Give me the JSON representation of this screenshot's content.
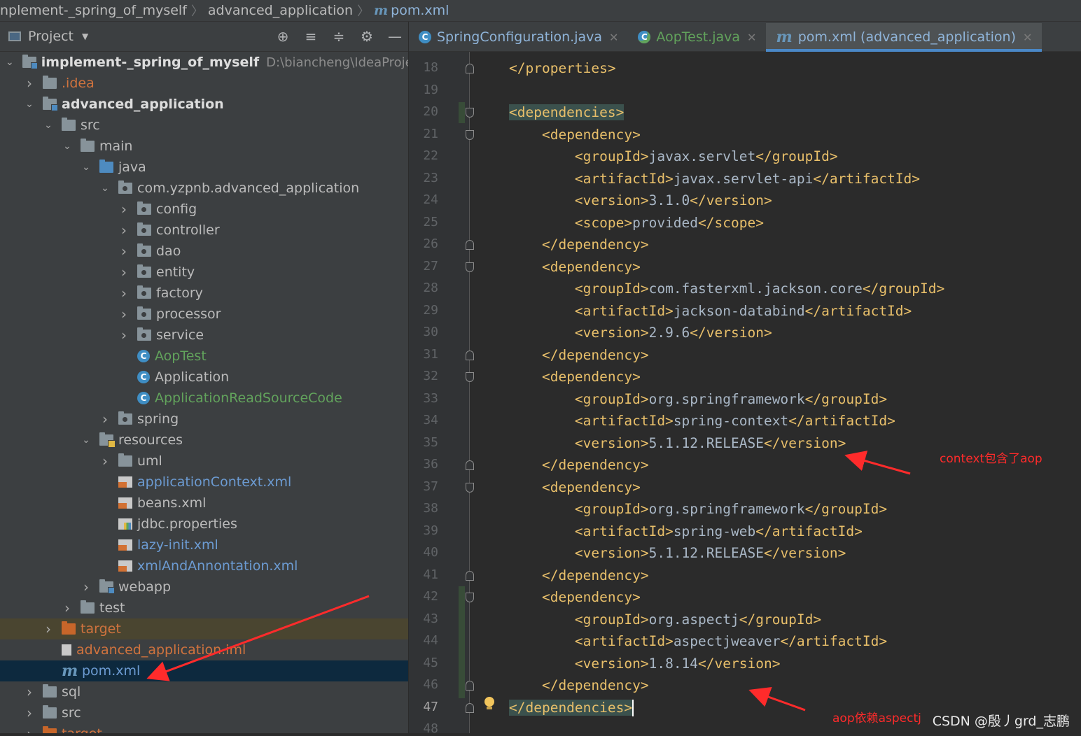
{
  "breadcrumb": {
    "root": "nplement-_spring_of_myself",
    "module": "advanced_application",
    "file": "pom.xml",
    "file_icon": "m"
  },
  "project_panel": {
    "title": "Project",
    "toolbar_icons": [
      "locate-icon",
      "expand-all-icon",
      "collapse-all-icon",
      "gear-icon",
      "minimize-icon"
    ],
    "tree": [
      {
        "label": "implement-_spring_of_myself",
        "path": "D:\\biancheng\\IdeaProjects\\ir",
        "icon": "module-folder",
        "style": "bold",
        "expanded": true
      },
      {
        "label": ".idea",
        "icon": "folder",
        "style": "orange",
        "expanded": false
      },
      {
        "label": "advanced_application",
        "icon": "module-folder",
        "style": "bold",
        "expanded": true
      },
      {
        "label": "src",
        "icon": "folder",
        "style": "normal",
        "expanded": true
      },
      {
        "label": "main",
        "icon": "folder",
        "style": "normal",
        "expanded": true
      },
      {
        "label": "java",
        "icon": "source-folder",
        "style": "normal",
        "expanded": true
      },
      {
        "label": "com.yzpnb.advanced_application",
        "icon": "package",
        "style": "normal",
        "expanded": true
      },
      {
        "label": "config",
        "icon": "package",
        "style": "normal",
        "expanded": false
      },
      {
        "label": "controller",
        "icon": "package",
        "style": "normal",
        "expanded": false
      },
      {
        "label": "dao",
        "icon": "package",
        "style": "normal",
        "expanded": false
      },
      {
        "label": "entity",
        "icon": "package",
        "style": "normal",
        "expanded": false
      },
      {
        "label": "factory",
        "icon": "package",
        "style": "normal",
        "expanded": false
      },
      {
        "label": "processor",
        "icon": "package",
        "style": "normal",
        "expanded": false
      },
      {
        "label": "service",
        "icon": "package",
        "style": "normal",
        "expanded": false
      },
      {
        "label": "AopTest",
        "icon": "class",
        "style": "green"
      },
      {
        "label": "Application",
        "icon": "class",
        "style": "normal"
      },
      {
        "label": "ApplicationReadSourceCode",
        "icon": "class",
        "style": "green"
      },
      {
        "label": "spring",
        "icon": "package",
        "style": "normal",
        "expanded": false
      },
      {
        "label": "resources",
        "icon": "resources-folder",
        "style": "normal",
        "expanded": true
      },
      {
        "label": "uml",
        "icon": "folder",
        "style": "normal",
        "expanded": false
      },
      {
        "label": "applicationContext.xml",
        "icon": "xml-file",
        "style": "blue"
      },
      {
        "label": "beans.xml",
        "icon": "xml-file",
        "style": "normal"
      },
      {
        "label": "jdbc.properties",
        "icon": "properties-file",
        "style": "normal"
      },
      {
        "label": "lazy-init.xml",
        "icon": "xml-file",
        "style": "blue"
      },
      {
        "label": "xmlAndAnnontation.xml",
        "icon": "xml-file",
        "style": "blue"
      },
      {
        "label": "webapp",
        "icon": "web-folder",
        "style": "normal",
        "expanded": false
      },
      {
        "label": "test",
        "icon": "folder",
        "style": "normal",
        "expanded": false
      },
      {
        "label": "target",
        "icon": "excluded-folder",
        "style": "orange",
        "expanded": false
      },
      {
        "label": "advanced_application.iml",
        "icon": "iml-file",
        "style": "orange"
      },
      {
        "label": "pom.xml",
        "icon": "maven-file",
        "style": "blue"
      },
      {
        "label": "sql",
        "icon": "folder",
        "style": "normal",
        "expanded": false
      },
      {
        "label": "src",
        "icon": "folder",
        "style": "normal",
        "expanded": false
      },
      {
        "label": "target",
        "icon": "excluded-folder",
        "style": "orange",
        "expanded": false
      }
    ]
  },
  "tabs": [
    {
      "label": "SpringConfiguration.java",
      "icon": "class-icon",
      "active": false,
      "color": "blue"
    },
    {
      "label": "AopTest.java",
      "icon": "test-class-icon",
      "active": false,
      "color": "green"
    },
    {
      "label": "pom.xml (advanced_application)",
      "icon": "maven-icon",
      "active": true,
      "color": "blue"
    }
  ],
  "editor": {
    "lines": [
      {
        "n": "18",
        "code": "</properties>"
      },
      {
        "n": "19",
        "code": ""
      },
      {
        "n": "20",
        "code": "<dependencies>"
      },
      {
        "n": "21",
        "code": "    <dependency>"
      },
      {
        "n": "22",
        "code": "        <groupId>javax.servlet</groupId>"
      },
      {
        "n": "23",
        "code": "        <artifactId>javax.servlet-api</artifactId>"
      },
      {
        "n": "24",
        "code": "        <version>3.1.0</version>"
      },
      {
        "n": "25",
        "code": "        <scope>provided</scope>"
      },
      {
        "n": "26",
        "code": "    </dependency>"
      },
      {
        "n": "27",
        "code": "    <dependency>"
      },
      {
        "n": "28",
        "code": "        <groupId>com.fasterxml.jackson.core</groupId>"
      },
      {
        "n": "29",
        "code": "        <artifactId>jackson-databind</artifactId>"
      },
      {
        "n": "30",
        "code": "        <version>2.9.6</version>"
      },
      {
        "n": "31",
        "code": "    </dependency>"
      },
      {
        "n": "32",
        "code": "    <dependency>"
      },
      {
        "n": "33",
        "code": "        <groupId>org.springframework</groupId>"
      },
      {
        "n": "34",
        "code": "        <artifactId>spring-context</artifactId>"
      },
      {
        "n": "35",
        "code": "        <version>5.1.12.RELEASE</version>"
      },
      {
        "n": "36",
        "code": "    </dependency>"
      },
      {
        "n": "37",
        "code": "    <dependency>"
      },
      {
        "n": "38",
        "code": "        <groupId>org.springframework</groupId>"
      },
      {
        "n": "39",
        "code": "        <artifactId>spring-web</artifactId>"
      },
      {
        "n": "40",
        "code": "        <version>5.1.12.RELEASE</version>"
      },
      {
        "n": "41",
        "code": "    </dependency>"
      },
      {
        "n": "42",
        "code": "    <dependency>"
      },
      {
        "n": "43",
        "code": "        <groupId>org.aspectj</groupId>"
      },
      {
        "n": "44",
        "code": "        <artifactId>aspectjweaver</artifactId>"
      },
      {
        "n": "45",
        "code": "        <version>1.8.14</version>"
      },
      {
        "n": "46",
        "code": "    </dependency>"
      },
      {
        "n": "47",
        "code": "</dependencies>"
      },
      {
        "n": "48",
        "code": ""
      }
    ]
  },
  "annotations": {
    "context_note": "context包含了aop",
    "aspectj_note": "aop依赖aspectj",
    "arrow_color": "#ff2b2b"
  },
  "watermark": "CSDN @殷丿grd_志鹏",
  "colors": {
    "tag": "#e8bf6a",
    "text": "#a9b7c6",
    "accent": "#4a88c7",
    "selection": "#0d293e"
  }
}
